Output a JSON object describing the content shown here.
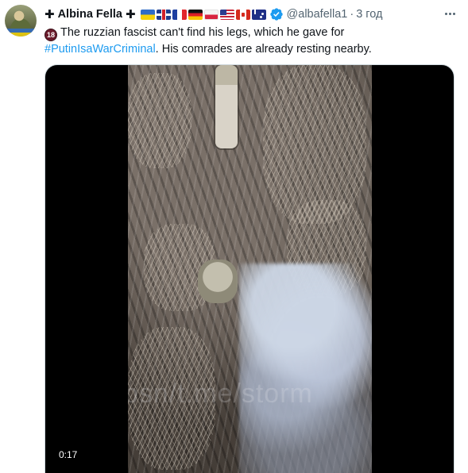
{
  "tweet": {
    "author": {
      "prefix_symbol": "✚",
      "name": "Albina Fella",
      "suffix_symbol": "✚",
      "flags": [
        "ua",
        "uk",
        "fr",
        "de",
        "pl",
        "us",
        "ca",
        "au"
      ],
      "verified_icon": "verified-badge-icon",
      "handle": "@albafella1",
      "separator": "·",
      "time": "3 год"
    },
    "text": {
      "age_badge": "18",
      "line1": "The ruzzian fascist can't find his legs, which he gave for",
      "hashtag": "#PutinIsaWarCriminal",
      "line2_rest": ". His comrades are already resting nearby."
    },
    "media": {
      "type": "video",
      "duration": "0:17",
      "watermark": "psn/t.me/storm"
    }
  },
  "colors": {
    "link": "#1d9bf0",
    "secondary_text": "#536471",
    "primary_text": "#0f1419",
    "verified": "#1d9bf0"
  }
}
